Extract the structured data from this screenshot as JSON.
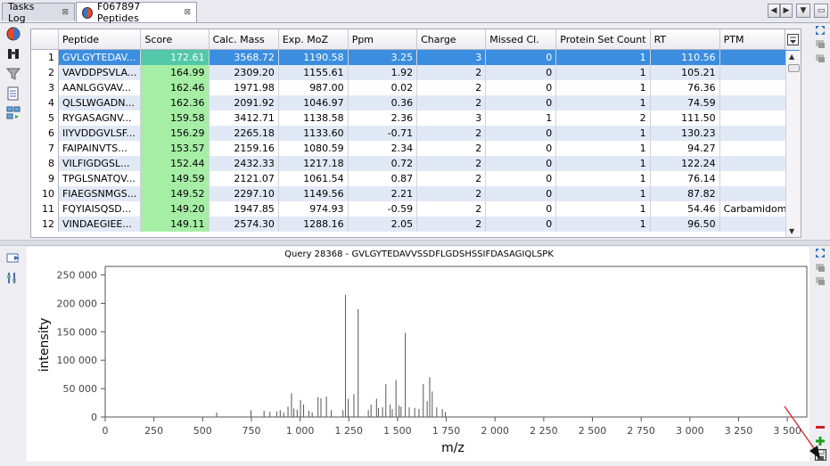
{
  "tabs": [
    {
      "label": "Tasks Log",
      "close": "⊠"
    },
    {
      "label": "F067897 Peptides",
      "close": "⊠"
    }
  ],
  "table": {
    "columns": [
      "Peptide",
      "Score",
      "Calc. Mass",
      "Exp. MoZ",
      "Ppm",
      "Charge",
      "Missed Cl.",
      "Protein Set Count",
      "RT",
      "PTM"
    ],
    "rows": [
      [
        "1",
        "GVLGYTEDAV...",
        "172.61",
        "3568.72",
        "1190.58",
        "3.25",
        "3",
        "0",
        "1",
        "110.56",
        ""
      ],
      [
        "2",
        "VAVDDPSVLA...",
        "164.99",
        "2309.20",
        "1155.61",
        "1.92",
        "2",
        "0",
        "1",
        "105.21",
        ""
      ],
      [
        "3",
        "AANLGGVAV...",
        "162.46",
        "1971.98",
        "987.00",
        "0.02",
        "2",
        "0",
        "1",
        "76.36",
        ""
      ],
      [
        "4",
        "QLSLWGADN...",
        "162.36",
        "2091.92",
        "1046.97",
        "0.36",
        "2",
        "0",
        "1",
        "74.59",
        ""
      ],
      [
        "5",
        "RYGASAGNV...",
        "159.58",
        "3412.71",
        "1138.58",
        "2.36",
        "3",
        "1",
        "2",
        "111.50",
        ""
      ],
      [
        "6",
        "IIYVDDGVLSF...",
        "156.29",
        "2265.18",
        "1133.60",
        "-0.71",
        "2",
        "0",
        "1",
        "130.23",
        ""
      ],
      [
        "7",
        "FAIPAINVTS...",
        "153.57",
        "2159.16",
        "1080.59",
        "2.34",
        "2",
        "0",
        "1",
        "94.27",
        ""
      ],
      [
        "8",
        "VILFIGDGSL...",
        "152.44",
        "2432.33",
        "1217.18",
        "0.72",
        "2",
        "0",
        "1",
        "122.24",
        ""
      ],
      [
        "9",
        "TPGLSNATQV...",
        "149.59",
        "2121.07",
        "1061.54",
        "0.87",
        "2",
        "0",
        "1",
        "76.14",
        ""
      ],
      [
        "10",
        "FIAEGSNMGS...",
        "149.52",
        "2297.10",
        "1149.56",
        "2.21",
        "2",
        "0",
        "1",
        "87.82",
        ""
      ],
      [
        "11",
        "FQYIAISQSD...",
        "149.20",
        "1947.85",
        "974.93",
        "-0.59",
        "2",
        "0",
        "1",
        "54.46",
        "Carbamidom..."
      ],
      [
        "12",
        "VINDAEGIEE...",
        "149.11",
        "2574.30",
        "1288.16",
        "2.05",
        "2",
        "0",
        "1",
        "96.50",
        ""
      ]
    ],
    "selected_row": 0
  },
  "icons": {
    "left_top": [
      "piechart-icon",
      "binoculars-icon",
      "filter-icon",
      "export-icon",
      "compare-icon"
    ],
    "left_bottom": [
      "export-icon",
      "settings-icon"
    ],
    "right_top": [
      "expand-icon",
      "collapse-icon",
      "collapse-icon-2"
    ],
    "right_bottom": [
      "expand-icon",
      "collapse-icon",
      "collapse-icon-2"
    ],
    "chart_controls": [
      "remove-icon",
      "add-icon",
      "save-icon"
    ]
  },
  "chart_data": {
    "type": "bar",
    "title": "Query 28368 - GVLGYTEDAVVSSDFLGDSHSSIFDASAGIQLSPK",
    "xlabel": "m/z",
    "ylabel": "intensity",
    "xlim": [
      0,
      3600
    ],
    "ylim": [
      0,
      265000
    ],
    "xticks": [
      0,
      250,
      500,
      750,
      1000,
      1250,
      1500,
      1750,
      2000,
      2250,
      2500,
      2750,
      3000,
      3250,
      3500
    ],
    "xtick_labels": [
      "0",
      "250",
      "500",
      "750",
      "1 000",
      "1 250",
      "1 500",
      "1 750",
      "2 000",
      "2 250",
      "2 500",
      "2 750",
      "3 000",
      "3 250",
      "3 500"
    ],
    "yticks": [
      0,
      50000,
      100000,
      150000,
      200000,
      250000
    ],
    "ytick_labels": [
      "0",
      "50 000",
      "100 000",
      "150 000",
      "200 000",
      "250 000"
    ],
    "grid": false,
    "peaks": [
      [
        572,
        8000
      ],
      [
        748,
        12000
      ],
      [
        815,
        11000
      ],
      [
        845,
        9000
      ],
      [
        880,
        10000
      ],
      [
        898,
        12000
      ],
      [
        916,
        8000
      ],
      [
        938,
        18000
      ],
      [
        956,
        42000
      ],
      [
        968,
        15000
      ],
      [
        985,
        13000
      ],
      [
        1002,
        30000
      ],
      [
        1018,
        22000
      ],
      [
        1045,
        11000
      ],
      [
        1062,
        8000
      ],
      [
        1092,
        35000
      ],
      [
        1107,
        33000
      ],
      [
        1135,
        36000
      ],
      [
        1160,
        12000
      ],
      [
        1220,
        12000
      ],
      [
        1233,
        215000
      ],
      [
        1247,
        32000
      ],
      [
        1276,
        40000
      ],
      [
        1298,
        190000
      ],
      [
        1350,
        12000
      ],
      [
        1364,
        22000
      ],
      [
        1392,
        32000
      ],
      [
        1402,
        16000
      ],
      [
        1423,
        17000
      ],
      [
        1440,
        58000
      ],
      [
        1462,
        22000
      ],
      [
        1473,
        14000
      ],
      [
        1492,
        65000
      ],
      [
        1508,
        20000
      ],
      [
        1518,
        18000
      ],
      [
        1540,
        148000
      ],
      [
        1560,
        17000
      ],
      [
        1588,
        16000
      ],
      [
        1610,
        14000
      ],
      [
        1632,
        58000
      ],
      [
        1652,
        28000
      ],
      [
        1665,
        70000
      ],
      [
        1678,
        45000
      ],
      [
        1701,
        17000
      ],
      [
        1730,
        14000
      ],
      [
        1745,
        9000
      ]
    ]
  }
}
